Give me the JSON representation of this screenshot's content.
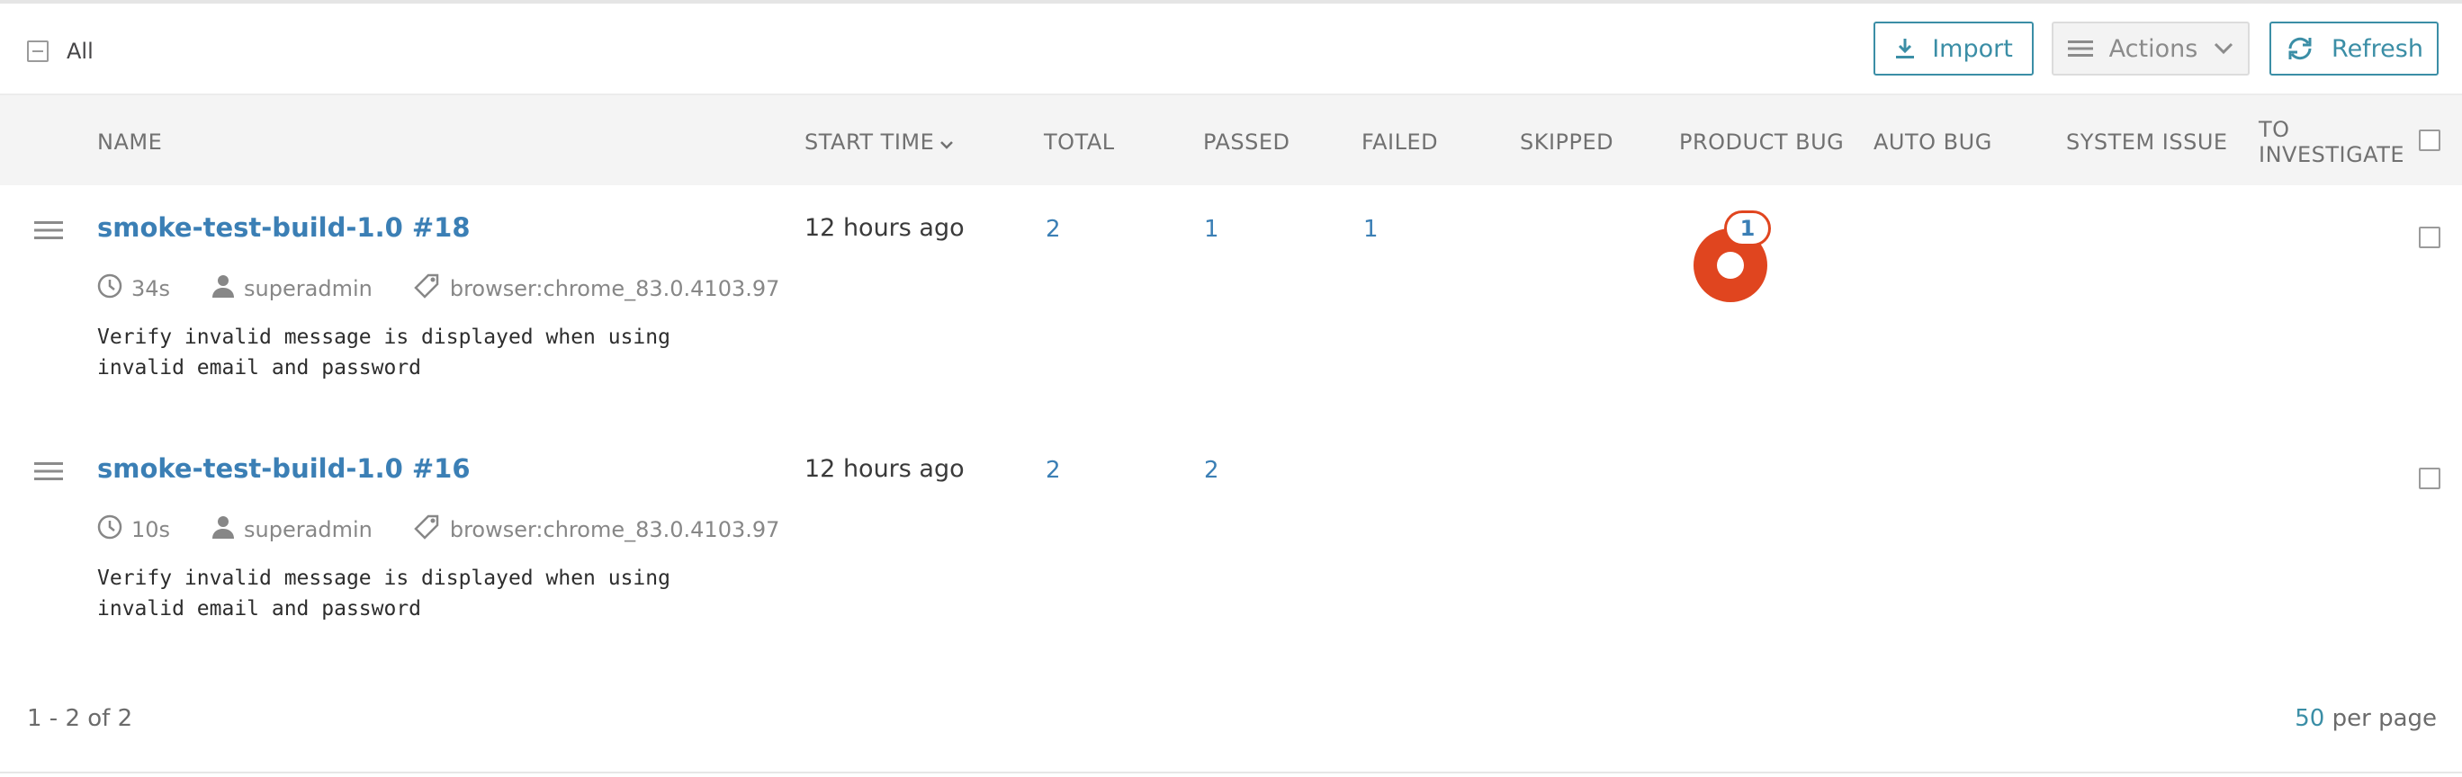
{
  "toolbar": {
    "select_all_label": "All",
    "import_label": "Import",
    "actions_label": "Actions",
    "refresh_label": "Refresh"
  },
  "columns": {
    "name": "NAME",
    "start_time": "START TIME",
    "total": "TOTAL",
    "passed": "PASSED",
    "failed": "FAILED",
    "skipped": "SKIPPED",
    "product_bug": "PRODUCT BUG",
    "auto_bug": "AUTO BUG",
    "system_issue": "SYSTEM ISSUE",
    "to_investigate_line1": "TO",
    "to_investigate_line2": "INVESTIGATE"
  },
  "rows": [
    {
      "name": "smoke-test-build-1.0 #18",
      "duration": "34s",
      "owner": "superadmin",
      "attribute": "browser:chrome_83.0.4103.97",
      "description_line1": "Verify invalid message is displayed when using",
      "description_line2": "invalid email and password",
      "start_time": "12 hours ago",
      "total": "2",
      "passed": "1",
      "failed": "1",
      "product_bug": "1"
    },
    {
      "name": "smoke-test-build-1.0 #16",
      "duration": "10s",
      "owner": "superadmin",
      "attribute": "browser:chrome_83.0.4103.97",
      "description_line1": "Verify invalid message is displayed when using",
      "description_line2": "invalid email and password",
      "start_time": "12 hours ago",
      "total": "2",
      "passed": "2"
    }
  ],
  "footer": {
    "range": "1 - 2 of 2",
    "per_page_count": "50",
    "per_page_label": " per page"
  },
  "colors": {
    "accent": "#3b8ea6",
    "link": "#3b7fb5",
    "product_bug": "#e0451f"
  }
}
